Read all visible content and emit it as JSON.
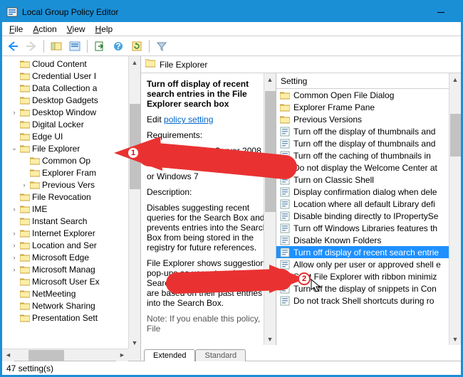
{
  "window": {
    "title": "Local Group Policy Editor"
  },
  "menus": {
    "file": "File",
    "action": "Action",
    "view": "View",
    "help": "Help"
  },
  "tree": {
    "items": [
      {
        "label": "Cloud Content",
        "depth": 1,
        "exp": ""
      },
      {
        "label": "Credential User I",
        "depth": 1,
        "exp": ""
      },
      {
        "label": "Data Collection a",
        "depth": 1,
        "exp": ""
      },
      {
        "label": "Desktop Gadgets",
        "depth": 1,
        "exp": ""
      },
      {
        "label": "Desktop Window",
        "depth": 1,
        "exp": ">"
      },
      {
        "label": "Digital Locker",
        "depth": 1,
        "exp": ""
      },
      {
        "label": "Edge UI",
        "depth": 1,
        "exp": ""
      },
      {
        "label": "File Explorer",
        "depth": 1,
        "exp": "v"
      },
      {
        "label": "Common Op",
        "depth": 2,
        "exp": ""
      },
      {
        "label": "Explorer Fram",
        "depth": 2,
        "exp": ""
      },
      {
        "label": "Previous Vers",
        "depth": 2,
        "exp": ">"
      },
      {
        "label": "File Revocation",
        "depth": 1,
        "exp": ""
      },
      {
        "label": "IME",
        "depth": 1,
        "exp": ">"
      },
      {
        "label": "Instant Search",
        "depth": 1,
        "exp": ""
      },
      {
        "label": "Internet Explorer",
        "depth": 1,
        "exp": ">"
      },
      {
        "label": "Location and Ser",
        "depth": 1,
        "exp": ">"
      },
      {
        "label": "Microsoft Edge",
        "depth": 1,
        "exp": ">"
      },
      {
        "label": "Microsoft Manag",
        "depth": 1,
        "exp": ">"
      },
      {
        "label": "Microsoft User Ex",
        "depth": 1,
        "exp": ""
      },
      {
        "label": "NetMeeting",
        "depth": 1,
        "exp": ""
      },
      {
        "label": "Network Sharing",
        "depth": 1,
        "exp": ""
      },
      {
        "label": "Presentation Sett",
        "depth": 1,
        "exp": ""
      }
    ]
  },
  "rp_header": {
    "title": "File Explorer"
  },
  "detail": {
    "title": "Turn off display of recent search entries in the File Explorer search box",
    "edit": "Edit",
    "link": "policy setting",
    "req_label": "Requirements:",
    "req1": "At least Windows Server 2008 R2",
    "req2": "or Windows 7",
    "desc_label": "Description:",
    "desc1": "Disables suggesting recent queries for the Search Box and prevents entries into the Search Box from being stored in the registry for future references.",
    "desc2": "File Explorer shows suggestion pop-ups as users type into the Search Box.  These suggestions are based on their past entries into the Search Box.",
    "note": "Note: If you enable this policy, File"
  },
  "list": {
    "header": "Setting",
    "items": [
      {
        "type": "folder",
        "label": "Common Open File Dialog"
      },
      {
        "type": "folder",
        "label": "Explorer Frame Pane"
      },
      {
        "type": "folder",
        "label": "Previous Versions"
      },
      {
        "type": "setting",
        "label": "Turn off the display of thumbnails and"
      },
      {
        "type": "setting",
        "label": "Turn off the display of thumbnails and"
      },
      {
        "type": "setting",
        "label": "Turn off the caching of thumbnails in"
      },
      {
        "type": "setting",
        "label": "Do not display the Welcome Center at"
      },
      {
        "type": "setting",
        "label": "Turn on Classic Shell"
      },
      {
        "type": "setting",
        "label": "Display confirmation dialog when dele"
      },
      {
        "type": "setting",
        "label": "Location where all default Library defi"
      },
      {
        "type": "setting",
        "label": "Disable binding directly to IPropertySe"
      },
      {
        "type": "setting",
        "label": "Turn off Windows Libraries features th"
      },
      {
        "type": "setting",
        "label": "Disable Known Folders"
      },
      {
        "type": "setting",
        "label": "Turn off display of recent search entrie",
        "selected": true
      },
      {
        "type": "setting",
        "label": "Allow only per user or approved shell e"
      },
      {
        "type": "setting",
        "label": "Start File Explorer with ribbon minimiz"
      },
      {
        "type": "setting",
        "label": "Turn off the display of snippets in Con"
      },
      {
        "type": "setting",
        "label": "Do not track Shell shortcuts during ro"
      }
    ]
  },
  "tabs": {
    "extended": "Extended",
    "standard": "Standard"
  },
  "status": {
    "text": "47 setting(s)"
  },
  "annotations": {
    "n1": "1",
    "n2": "2"
  },
  "icons": {
    "tool_back": "back-arrow-icon",
    "tool_forward": "forward-arrow-icon",
    "tool_up": "up-folder-icon",
    "tool_props": "properties-icon",
    "tool_export": "export-icon",
    "tool_help": "help-icon",
    "tool_refresh": "refresh-icon",
    "tool_filter": "filter-icon"
  }
}
